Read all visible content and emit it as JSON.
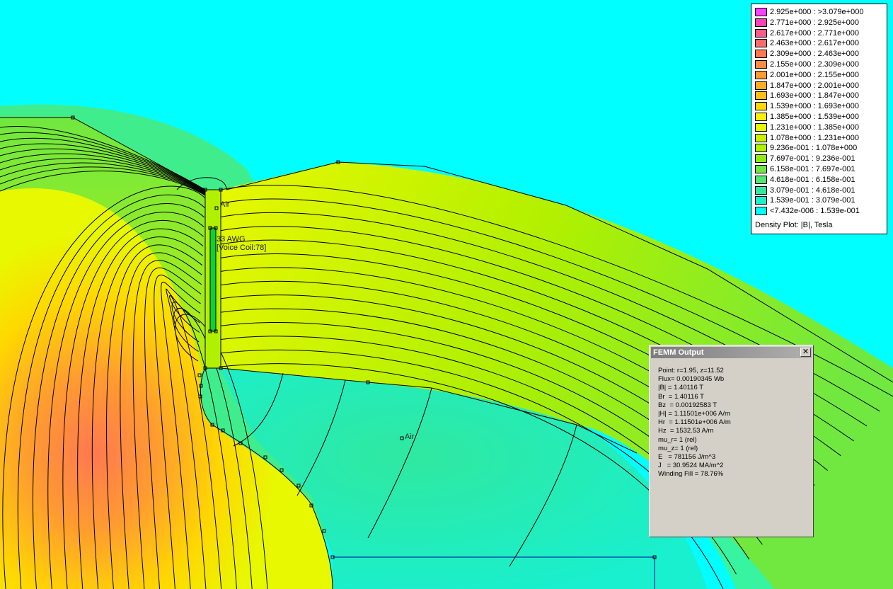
{
  "window": {
    "title": "FEMM Output",
    "close_icon": "close-icon"
  },
  "output": {
    "lines": [
      "Point: r=1.95, z=11.52",
      "Flux= 0.00190345 Wb",
      "|B| = 1.40116 T",
      "Br  = 1.40116 T",
      "Bz  = 0.00192583 T",
      "|H| = 1.11501e+006 A/m",
      "Hr  = 1.11501e+006 A/m",
      "Hz  = 1532.53 A/m",
      "mu_r= 1 (rel)",
      "mu_z= 1 (rel)",
      "E   = 781156 J/m^3",
      "J   = 30.9524 MA/m^2",
      "Winding Fill = 78.76%"
    ]
  },
  "legend": {
    "caption": "Density Plot: |B|, Tesla",
    "entries": [
      {
        "range": "2.925e+000 : >3.079e+000",
        "color": "#ff40ff"
      },
      {
        "range": "2.771e+000 : 2.925e+000",
        "color": "#ff40b8"
      },
      {
        "range": "2.617e+000 : 2.771e+000",
        "color": "#ff5a8c"
      },
      {
        "range": "2.463e+000 : 2.617e+000",
        "color": "#ff6a6a"
      },
      {
        "range": "2.309e+000 : 2.463e+000",
        "color": "#ff7850"
      },
      {
        "range": "2.155e+000 : 2.309e+000",
        "color": "#ff8a40"
      },
      {
        "range": "2.001e+000 : 2.155e+000",
        "color": "#ff9c30"
      },
      {
        "range": "1.847e+000 : 2.001e+000",
        "color": "#ffae20"
      },
      {
        "range": "1.693e+000 : 1.847e+000",
        "color": "#ffc010"
      },
      {
        "range": "1.539e+000 : 1.693e+000",
        "color": "#ffd800"
      },
      {
        "range": "1.385e+000 : 1.539e+000",
        "color": "#fff000"
      },
      {
        "range": "1.231e+000 : 1.385e+000",
        "color": "#e8f800"
      },
      {
        "range": "1.078e+000 : 1.231e+000",
        "color": "#ccf000"
      },
      {
        "range": "9.236e-001 : 1.078e+000",
        "color": "#b0f000"
      },
      {
        "range": "7.697e-001 : 9.236e-001",
        "color": "#90ec10"
      },
      {
        "range": "6.158e-001 : 7.697e-001",
        "color": "#70e840"
      },
      {
        "range": "4.618e-001 : 6.158e-001",
        "color": "#50e870"
      },
      {
        "range": "3.079e-001 : 4.618e-001",
        "color": "#30e8a0"
      },
      {
        "range": "1.539e-001 : 3.079e-001",
        "color": "#18f0d0"
      },
      {
        "range": "<7.432e-006 : 1.539e-001",
        "color": "#00ffff"
      }
    ]
  },
  "plot_labels": {
    "air_gap": "Air",
    "coil_material": "33 AWG",
    "coil_circuit": "[Voice Coil:78]",
    "air_region": "Air"
  }
}
